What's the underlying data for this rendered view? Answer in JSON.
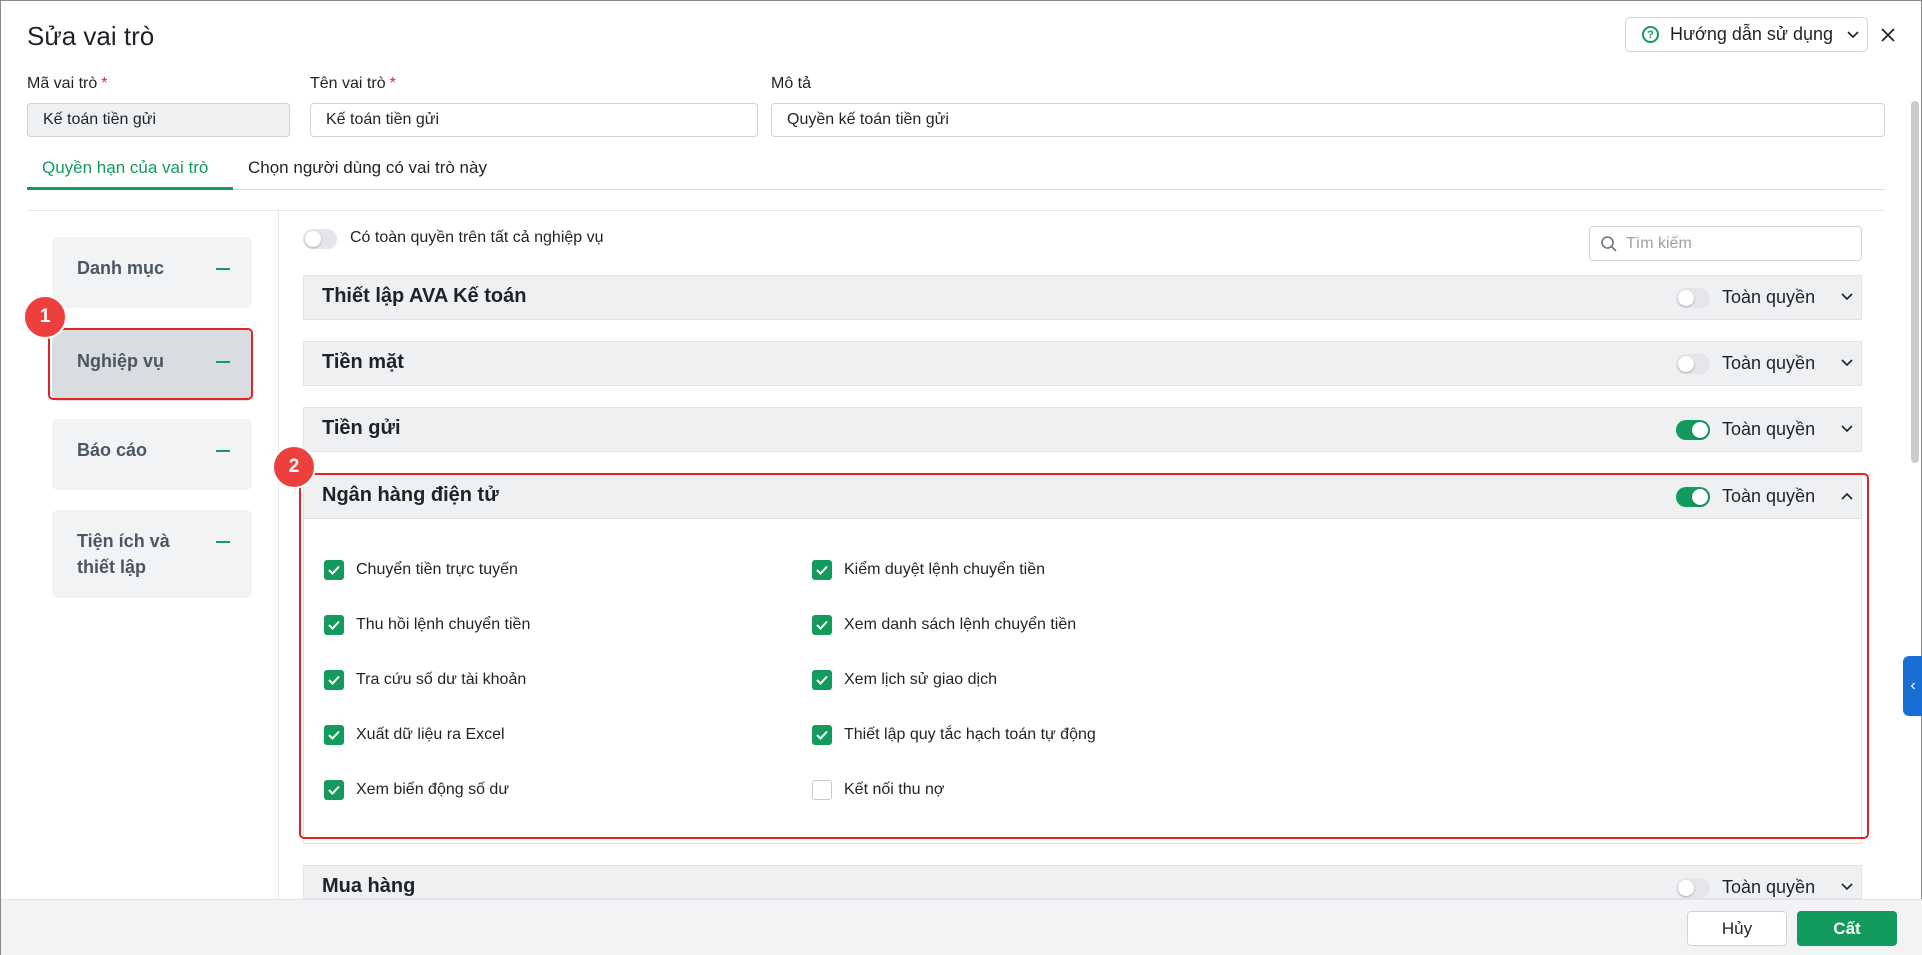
{
  "dialog": {
    "title": "Sửa vai trò",
    "help_label": "Hướng dẫn sử dụng"
  },
  "form": {
    "code_label": "Mã vai trò",
    "code_value": "Kế toán tiền gửi",
    "name_label": "Tên vai trò",
    "name_value": "Kế toán tiền gửi",
    "desc_label": "Mô tả",
    "desc_value": "Quyền kế toán tiền gửi",
    "required_mark": "*"
  },
  "tabs": [
    {
      "label": "Quyền hạn của vai trò",
      "active": true
    },
    {
      "label": "Chọn người dùng có vai trò này",
      "active": false
    }
  ],
  "categories": [
    {
      "label": "Danh mục"
    },
    {
      "label": "Nghiệp vụ",
      "selected": true
    },
    {
      "label": "Báo cáo"
    },
    {
      "label": "Tiện ích và thiết lập"
    }
  ],
  "badges": {
    "one": "1",
    "two": "2"
  },
  "all_permissions_label": "Có toàn quyền trên tất cả nghiệp vụ",
  "search": {
    "placeholder": "Tìm kiếm"
  },
  "full_perm_label": "Toàn quyền",
  "sections": [
    {
      "title": "Thiết lập AVA Kế toán",
      "full": false,
      "expanded": false
    },
    {
      "title": "Tiền mặt",
      "full": false,
      "expanded": false
    },
    {
      "title": "Tiền gửi",
      "full": true,
      "expanded": false
    },
    {
      "title": "Ngân hàng điện tử",
      "full": true,
      "expanded": true
    },
    {
      "title": "Mua hàng",
      "full": false,
      "expanded": false
    }
  ],
  "permissions": [
    {
      "label": "Chuyển tiền trực tuyến",
      "checked": true
    },
    {
      "label": "Kiểm duyệt lệnh chuyển tiền",
      "checked": true
    },
    {
      "label": "Thu hồi lệnh chuyển tiền",
      "checked": true
    },
    {
      "label": "Xem danh sách lệnh chuyển tiền",
      "checked": true
    },
    {
      "label": "Tra cứu số dư tài khoản",
      "checked": true
    },
    {
      "label": "Xem lịch sử giao dịch",
      "checked": true
    },
    {
      "label": "Xuất dữ liệu ra Excel",
      "checked": true
    },
    {
      "label": "Thiết lập quy tắc hạch toán tự động",
      "checked": true
    },
    {
      "label": "Xem biến động số dư",
      "checked": true
    },
    {
      "label": "Kết nối thu nợ",
      "checked": false
    }
  ],
  "footer": {
    "cancel_label": "Hủy",
    "save_label": "Cất"
  },
  "colors": {
    "accent": "#129b5c",
    "highlight": "#e02424",
    "side_tab": "#1a6fd4"
  }
}
